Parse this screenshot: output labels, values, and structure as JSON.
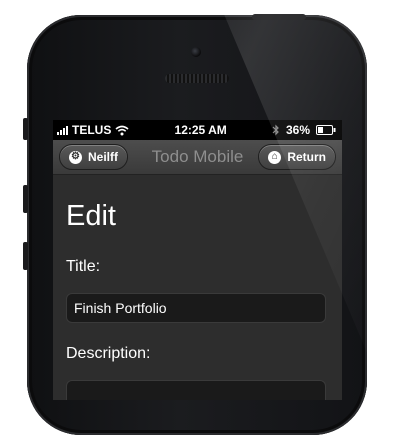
{
  "status_bar": {
    "carrier": "TELUS",
    "time": "12:25 AM",
    "battery": "36%"
  },
  "nav": {
    "title": "Todo Mobile",
    "left_button": "Neilff",
    "right_button": "Return"
  },
  "form": {
    "heading": "Edit",
    "title_label": "Title:",
    "title_value": "Finish Portfolio",
    "description_label": "Description:",
    "description_value": ""
  }
}
